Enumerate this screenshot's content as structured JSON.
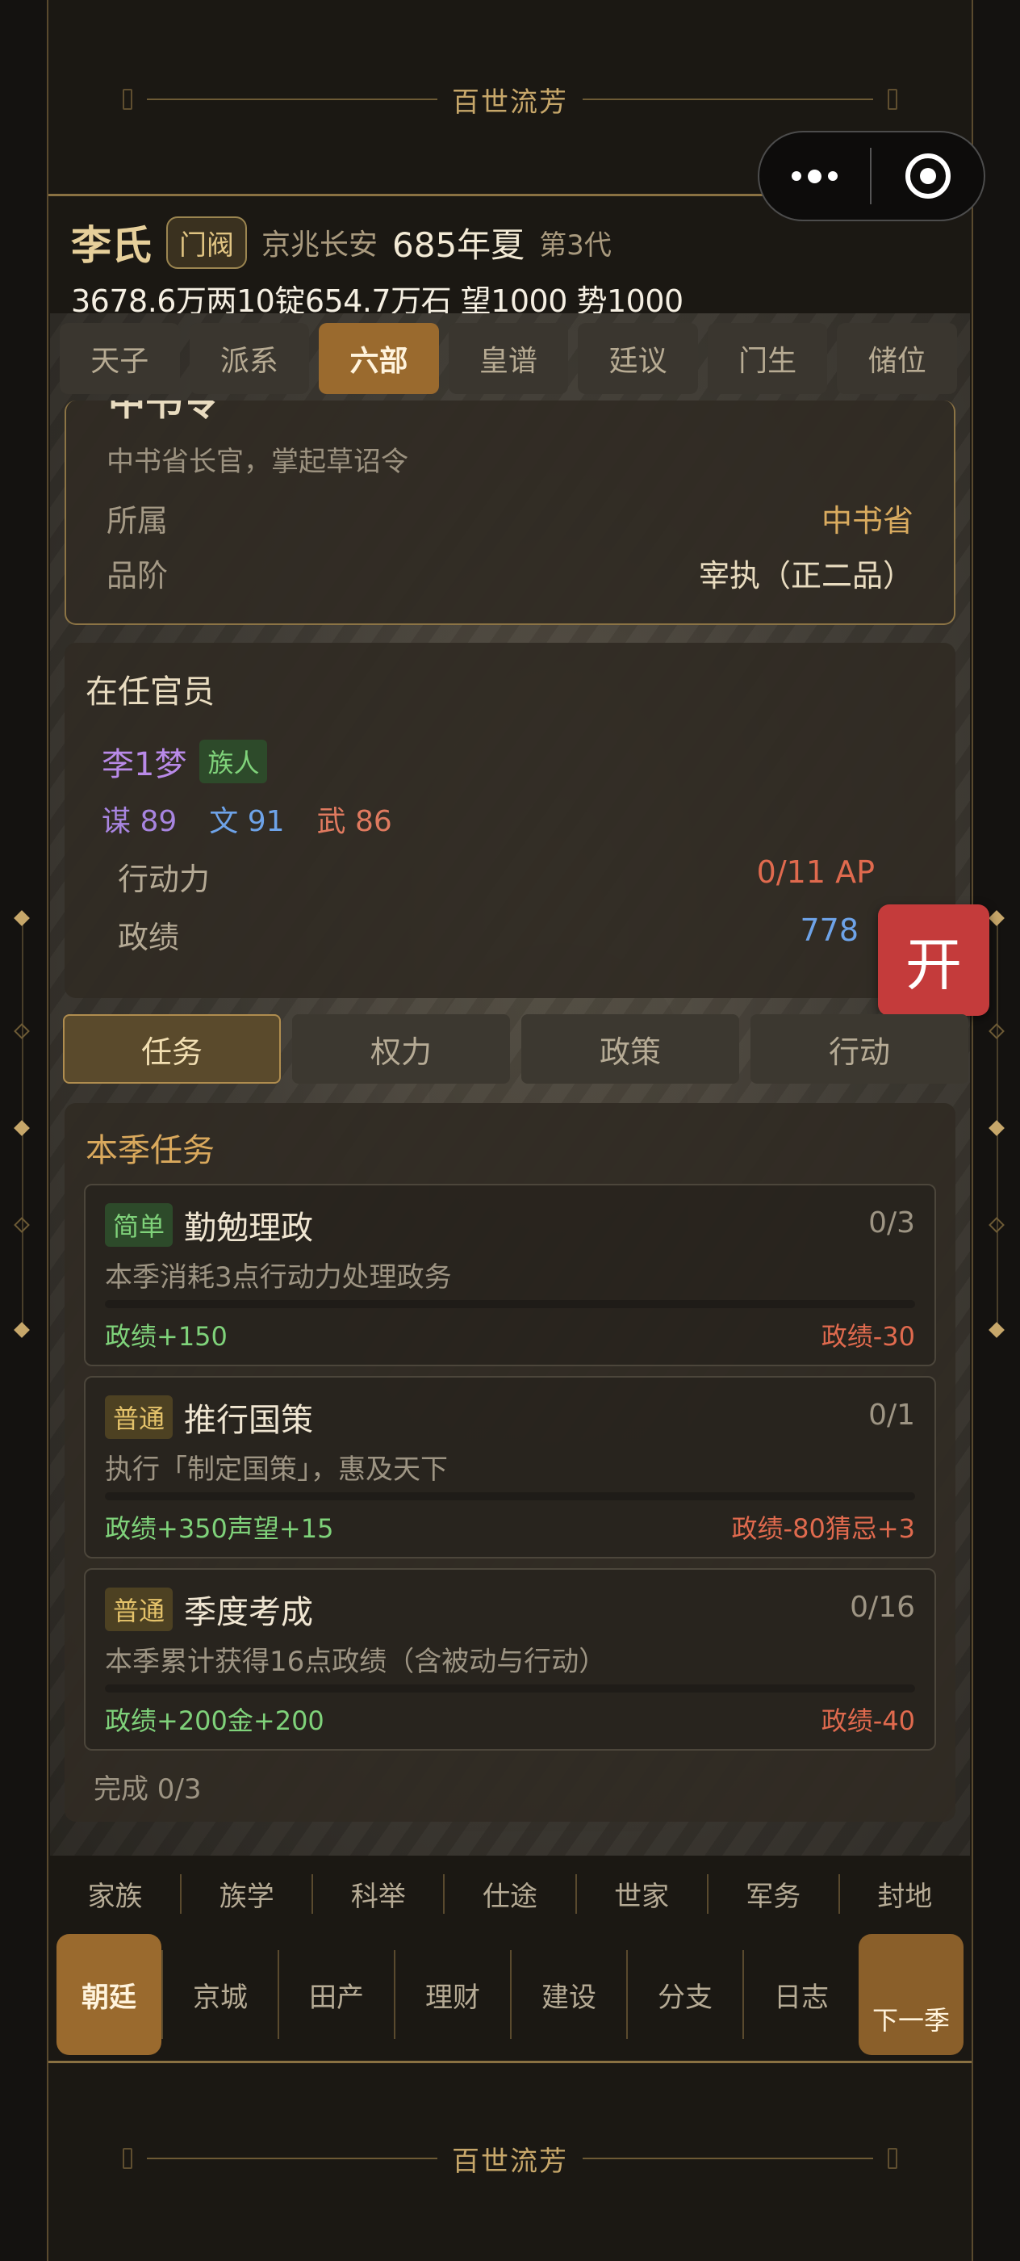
{
  "app": {
    "banner_title": "百世流芳"
  },
  "header": {
    "family": "李氏",
    "family_tag": "门阀",
    "location": "京兆长安",
    "date": "685年夏",
    "generation": "第3代",
    "resources": "3678.6万两10锭654.7万石  望1000 势1000"
  },
  "top_tabs": [
    {
      "label": "天子",
      "active": false
    },
    {
      "label": "派系",
      "active": false
    },
    {
      "label": "六部",
      "active": true
    },
    {
      "label": "皇谱",
      "active": false
    },
    {
      "label": "廷议",
      "active": false
    },
    {
      "label": "门生",
      "active": false
    },
    {
      "label": "储位",
      "active": false
    }
  ],
  "office": {
    "name": "中书令",
    "description": "中书省长官，掌起草诏令",
    "affiliation_label": "所属",
    "affiliation_value": "中书省",
    "rank_label": "品阶",
    "rank_value": "宰执（正二品）"
  },
  "officials": {
    "heading": "在任官员",
    "person_name": "李1梦",
    "person_tag": "族人",
    "stat_strategy": "谋 89",
    "stat_literary": "文 91",
    "stat_martial": "武 86",
    "ap_label": "行动力",
    "ap_value": "0/11 AP",
    "merit_label": "政绩",
    "merit_value": "778"
  },
  "open_button": "开",
  "sub_tabs": [
    {
      "label": "任务",
      "active": true
    },
    {
      "label": "权力",
      "active": false
    },
    {
      "label": "政策",
      "active": false
    },
    {
      "label": "行动",
      "active": false
    }
  ],
  "tasks": {
    "heading": "本季任务",
    "items": [
      {
        "level": "简单",
        "level_type": "easy",
        "name": "勤勉理政",
        "progress": "0/3",
        "progress_fraction": 0,
        "description": "本季消耗3点行动力处理政务",
        "reward": "政绩+150",
        "penalty": "政绩-30"
      },
      {
        "level": "普通",
        "level_type": "norm",
        "name": "推行国策",
        "progress": "0/1",
        "progress_fraction": 0,
        "description": "执行「制定国策」，惠及天下",
        "reward": "政绩+350声望+15",
        "penalty": "政绩-80猜忌+3"
      },
      {
        "level": "普通",
        "level_type": "norm",
        "name": "季度考成",
        "progress": "0/16",
        "progress_fraction": 0,
        "description": "本季累计获得16点政绩（含被动与行动）",
        "reward": "政绩+200金+200",
        "penalty": "政绩-40"
      }
    ],
    "completion": "完成 0/3"
  },
  "nav_primary": [
    "家族",
    "族学",
    "科举",
    "仕途",
    "世家",
    "军务",
    "封地"
  ],
  "nav_secondary": {
    "active": "朝廷",
    "items": [
      "京城",
      "田产",
      "理财",
      "建设",
      "分支",
      "日志"
    ],
    "next": "下一季"
  }
}
